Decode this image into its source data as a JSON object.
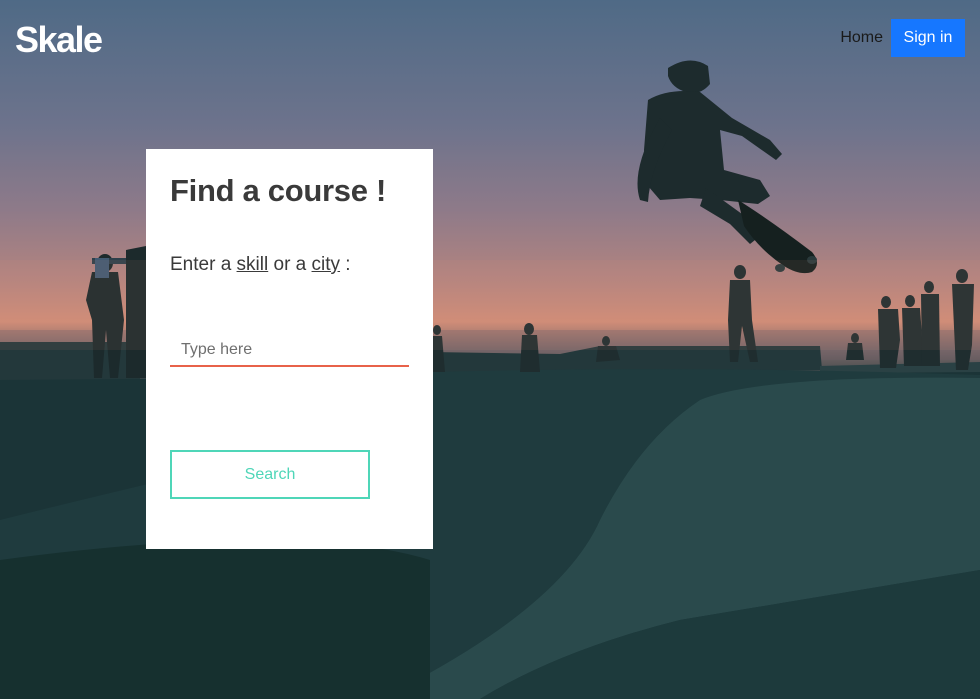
{
  "header": {
    "logo": "Skale",
    "nav": {
      "home_label": "Home",
      "signin_label": "Sign in"
    }
  },
  "search_card": {
    "title": "Find a course !",
    "prompt": {
      "prefix": "Enter a ",
      "skill": "skill",
      "middle": " or a ",
      "city": "city",
      "suffix": " :"
    },
    "input": {
      "placeholder": "Type here",
      "value": ""
    },
    "button_label": "Search"
  },
  "colors": {
    "signin_bg": "#1677ff",
    "input_underline": "#e8624a",
    "search_accent": "#4fd6b8",
    "heading_text": "#3a3a3a"
  },
  "background": {
    "description_icon": "skatepark-sunset-photo"
  }
}
